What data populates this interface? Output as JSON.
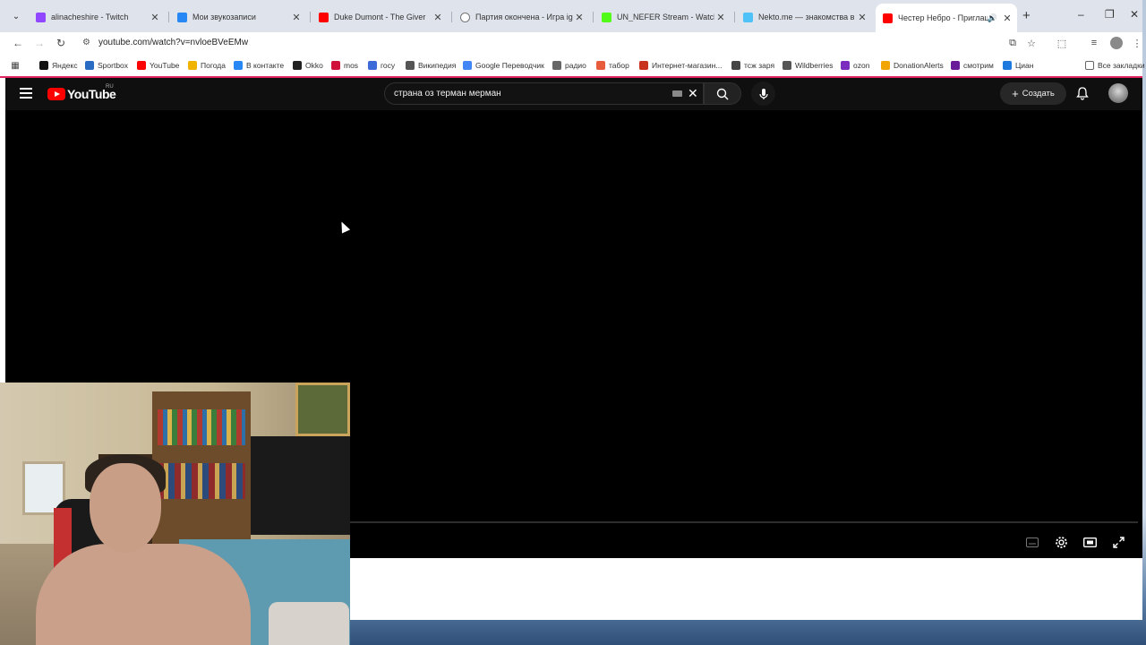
{
  "browser": {
    "tabs": [
      {
        "title": "alinacheshire - Twitch",
        "favicon": "twitch-icon",
        "color": "#9146ff"
      },
      {
        "title": "Мои звукозаписи",
        "favicon": "vk-audio-icon",
        "color": "#2787f5"
      },
      {
        "title": "Duke Dumont - The Giver",
        "favicon": "youtube-icon",
        "color": "#ff0000"
      },
      {
        "title": "Партия окончена - Игра iguar",
        "favicon": "chess-icon",
        "color": "#777777"
      },
      {
        "title": "UN_NEFER Stream - Watch Live",
        "favicon": "kick-icon",
        "color": "#53fc18"
      },
      {
        "title": "Nekto.me — знакомства в чате",
        "favicon": "nekto-icon",
        "color": "#4fc3f7"
      },
      {
        "title": "Честер Небро - Приглаше",
        "favicon": "youtube-icon",
        "color": "#ff0000",
        "active": true
      }
    ],
    "url": "youtube.com/watch?v=nvloeBVeEMw",
    "bookmarks": [
      {
        "label": "Яндекс",
        "icon": "yandex-icon",
        "color": "#111111"
      },
      {
        "label": "Sportbox",
        "icon": "sportbox-icon",
        "color": "#2a6cc4"
      },
      {
        "label": "YouTube",
        "icon": "youtube-icon",
        "color": "#ff0000"
      },
      {
        "label": "Погода",
        "icon": "weather-icon",
        "color": "#f0b400"
      },
      {
        "label": "В контакте",
        "icon": "vk-icon",
        "color": "#2787f5"
      },
      {
        "label": "Okko",
        "icon": "okko-icon",
        "color": "#222222"
      },
      {
        "label": "mos",
        "icon": "mos-icon",
        "color": "#d0103a"
      },
      {
        "label": "госу",
        "icon": "gosuslugi-icon",
        "color": "#3c6ad8"
      },
      {
        "label": "Википедия",
        "icon": "wikipedia-icon",
        "color": "#555555"
      },
      {
        "label": "Google Переводчик",
        "icon": "translate-icon",
        "color": "#4285f4"
      },
      {
        "label": "радио",
        "icon": "folder-icon",
        "color": "#666666"
      },
      {
        "label": "табор",
        "icon": "tabor-icon",
        "color": "#e65c3c"
      },
      {
        "label": "Интернет-магазин...",
        "icon": "shop-icon",
        "color": "#c8321e"
      },
      {
        "label": "тсж заря",
        "icon": "tsj-icon",
        "color": "#444444"
      },
      {
        "label": "Wildberries",
        "icon": "wildberries-icon",
        "color": "#555555"
      },
      {
        "label": "ozon",
        "icon": "ozon-icon",
        "color": "#7b2cbf"
      },
      {
        "label": "DonationAlerts",
        "icon": "donationalerts-icon",
        "color": "#f2a400"
      },
      {
        "label": "смотрим",
        "icon": "smotrim-icon",
        "color": "#6a1b9a"
      },
      {
        "label": "Циан",
        "icon": "cian-icon",
        "color": "#1f7ae0"
      }
    ],
    "all_bookmarks": "Все закладки"
  },
  "youtube": {
    "logo_text": "YouTube",
    "region": "RU",
    "search_value": "страна оз терман мерман",
    "create_label": "Создать"
  }
}
